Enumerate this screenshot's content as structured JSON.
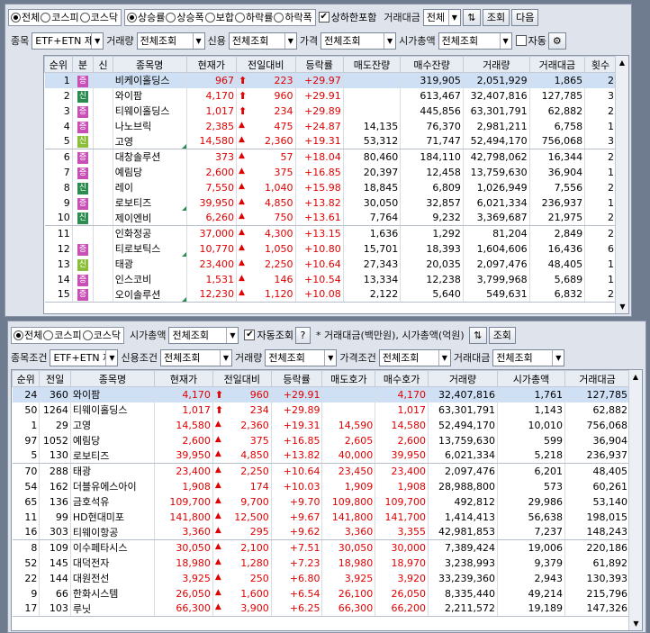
{
  "top": {
    "market_radios": [
      "전체",
      "코스피",
      "코스닥"
    ],
    "market_selected": 0,
    "sort_radios": [
      "상승률",
      "상승폭",
      "보합",
      "하락률",
      "하락폭"
    ],
    "sort_selected": 0,
    "limit_check_label": "상하한포함",
    "limit_checked": true,
    "amount_label": "거래대금",
    "amount_value": "전체",
    "query_label": "조회",
    "next_label": "다음",
    "item_label": "종목",
    "item_value": "ETF+ETN 제외",
    "volume_label": "거래량",
    "volume_value": "전체조회",
    "credit_label": "신용",
    "credit_value": "전체조회",
    "price_label": "가격",
    "price_value": "전체조회",
    "mcap_label": "시가총액",
    "mcap_value": "전체조회",
    "auto_label": "자동",
    "auto_checked": false,
    "columns": [
      "순위",
      "분",
      "신",
      "종목명",
      "현재가",
      "전일대비",
      "등락률",
      "매도잔량",
      "매수잔량",
      "거래량",
      "거래대금",
      "횟수"
    ],
    "rows": [
      {
        "rank": "1",
        "b": "증",
        "bt": "z",
        "name": "비케이홀딩스",
        "price": "967",
        "arrow": "up",
        "chg": "223",
        "rate": "+29.97",
        "ask": "",
        "bid": "319,905",
        "vol": "2,051,929",
        "amt": "1,865",
        "cnt": "2",
        "sel": true,
        "mark": false
      },
      {
        "rank": "2",
        "b": "신",
        "bt": "s",
        "name": "와이팜",
        "price": "4,170",
        "arrow": "up",
        "chg": "960",
        "rate": "+29.91",
        "ask": "",
        "bid": "613,467",
        "vol": "32,407,816",
        "amt": "127,785",
        "cnt": "3",
        "sel": false,
        "mark": false
      },
      {
        "rank": "3",
        "b": "증",
        "bt": "z",
        "name": "티웨이홀딩스",
        "price": "1,017",
        "arrow": "up",
        "chg": "234",
        "rate": "+29.89",
        "ask": "",
        "bid": "445,856",
        "vol": "63,301,791",
        "amt": "62,882",
        "cnt": "2",
        "sel": false,
        "mark": false
      },
      {
        "rank": "4",
        "b": "증",
        "bt": "z",
        "name": "나노브릭",
        "price": "2,385",
        "arrow": "tri",
        "chg": "475",
        "rate": "+24.87",
        "ask": "14,135",
        "bid": "76,370",
        "vol": "2,981,211",
        "amt": "6,758",
        "cnt": "1",
        "sel": false,
        "mark": false
      },
      {
        "rank": "5",
        "b": "신",
        "bt": "s2",
        "name": "고영",
        "price": "14,580",
        "arrow": "tri",
        "chg": "2,360",
        "rate": "+19.31",
        "ask": "53,312",
        "bid": "71,747",
        "vol": "52,494,170",
        "amt": "756,068",
        "cnt": "3",
        "sel": false,
        "mark": true
      },
      {
        "rank": "6",
        "b": "증",
        "bt": "z",
        "name": "대창솔루션",
        "price": "373",
        "arrow": "tri",
        "chg": "57",
        "rate": "+18.04",
        "ask": "80,460",
        "bid": "184,110",
        "vol": "42,798,062",
        "amt": "16,344",
        "cnt": "2",
        "sel": false,
        "mark": false
      },
      {
        "rank": "7",
        "b": "증",
        "bt": "z",
        "name": "예림당",
        "price": "2,600",
        "arrow": "tri",
        "chg": "375",
        "rate": "+16.85",
        "ask": "20,397",
        "bid": "12,458",
        "vol": "13,759,630",
        "amt": "36,904",
        "cnt": "1",
        "sel": false,
        "mark": false
      },
      {
        "rank": "8",
        "b": "신",
        "bt": "s",
        "name": "레이",
        "price": "7,550",
        "arrow": "tri",
        "chg": "1,040",
        "rate": "+15.98",
        "ask": "18,845",
        "bid": "6,809",
        "vol": "1,026,949",
        "amt": "7,556",
        "cnt": "2",
        "sel": false,
        "mark": false
      },
      {
        "rank": "9",
        "b": "증",
        "bt": "z",
        "name": "로보티즈",
        "price": "39,950",
        "arrow": "tri",
        "chg": "4,850",
        "rate": "+13.82",
        "ask": "30,050",
        "bid": "32,857",
        "vol": "6,021,334",
        "amt": "236,937",
        "cnt": "1",
        "sel": false,
        "mark": true
      },
      {
        "rank": "10",
        "b": "신",
        "bt": "s",
        "name": "제이엔비",
        "price": "6,260",
        "arrow": "tri",
        "chg": "750",
        "rate": "+13.61",
        "ask": "7,764",
        "bid": "9,232",
        "vol": "3,369,687",
        "amt": "21,975",
        "cnt": "2",
        "sel": false,
        "mark": false
      },
      {
        "rank": "11",
        "b": "",
        "bt": "",
        "name": "인화정공",
        "price": "37,000",
        "arrow": "tri",
        "chg": "4,300",
        "rate": "+13.15",
        "ask": "1,636",
        "bid": "1,292",
        "vol": "81,204",
        "amt": "2,849",
        "cnt": "2",
        "sel": false,
        "mark": false
      },
      {
        "rank": "12",
        "b": "증",
        "bt": "z",
        "name": "티로보틱스",
        "price": "10,770",
        "arrow": "tri",
        "chg": "1,050",
        "rate": "+10.80",
        "ask": "15,701",
        "bid": "18,393",
        "vol": "1,604,606",
        "amt": "16,436",
        "cnt": "6",
        "sel": false,
        "mark": true
      },
      {
        "rank": "13",
        "b": "신",
        "bt": "s2",
        "name": "태광",
        "price": "23,400",
        "arrow": "tri",
        "chg": "2,250",
        "rate": "+10.64",
        "ask": "27,343",
        "bid": "20,035",
        "vol": "2,097,476",
        "amt": "48,405",
        "cnt": "1",
        "sel": false,
        "mark": false
      },
      {
        "rank": "14",
        "b": "증",
        "bt": "z",
        "name": "인스코비",
        "price": "1,531",
        "arrow": "tri",
        "chg": "146",
        "rate": "+10.54",
        "ask": "13,334",
        "bid": "12,238",
        "vol": "3,799,968",
        "amt": "5,689",
        "cnt": "1",
        "sel": false,
        "mark": false
      },
      {
        "rank": "15",
        "b": "증",
        "bt": "z",
        "name": "오이솔루션",
        "price": "12,230",
        "arrow": "tri",
        "chg": "1,120",
        "rate": "+10.08",
        "ask": "2,122",
        "bid": "5,640",
        "vol": "549,631",
        "amt": "6,832",
        "cnt": "2",
        "sel": false,
        "mark": true
      }
    ]
  },
  "bottom": {
    "market_radios": [
      "전체",
      "코스피",
      "코스닥"
    ],
    "market_selected": 0,
    "mcap_label": "시가총액",
    "mcap_value": "전체조회",
    "auto_query_label": "자동조회",
    "auto_checked": true,
    "help_label": "?",
    "note": "* 거래대금(백만원), 시가총액(억원)",
    "query_label": "조회",
    "cond_label": "종목조건",
    "cond_value": "ETF+ETN 제외",
    "credit_label": "신용조건",
    "credit_value": "전체조회",
    "volume_label": "거래량",
    "volume_value": "전체조회",
    "price_label": "가격조건",
    "price_value": "전체조회",
    "amount_label": "거래대금",
    "amount_value": "전체조회",
    "columns": [
      "순위",
      "전일",
      "종목명",
      "현재가",
      "전일대비",
      "등락률",
      "매도호가",
      "매수호가",
      "거래량",
      "시가총액",
      "거래대금"
    ],
    "rows": [
      {
        "rank": "24",
        "prev": "360",
        "name": "와이팜",
        "price": "4,170",
        "arrow": "up",
        "chg": "960",
        "rate": "+29.91",
        "ask": "",
        "bid": "4,170",
        "vol": "32,407,816",
        "mcap": "1,761",
        "amt": "127,785",
        "sel": true
      },
      {
        "rank": "50",
        "prev": "1264",
        "name": "티웨이홀딩스",
        "price": "1,017",
        "arrow": "up",
        "chg": "234",
        "rate": "+29.89",
        "ask": "",
        "bid": "1,017",
        "vol": "63,301,791",
        "mcap": "1,143",
        "amt": "62,882",
        "sel": false
      },
      {
        "rank": "1",
        "prev": "29",
        "name": "고영",
        "price": "14,580",
        "arrow": "tri",
        "chg": "2,360",
        "rate": "+19.31",
        "ask": "14,590",
        "bid": "14,580",
        "vol": "52,494,170",
        "mcap": "10,010",
        "amt": "756,068",
        "sel": false
      },
      {
        "rank": "97",
        "prev": "1052",
        "name": "예림당",
        "price": "2,600",
        "arrow": "tri",
        "chg": "375",
        "rate": "+16.85",
        "ask": "2,605",
        "bid": "2,600",
        "vol": "13,759,630",
        "mcap": "599",
        "amt": "36,904",
        "sel": false
      },
      {
        "rank": "5",
        "prev": "130",
        "name": "로보티즈",
        "price": "39,950",
        "arrow": "tri",
        "chg": "4,850",
        "rate": "+13.82",
        "ask": "40,000",
        "bid": "39,950",
        "vol": "6,021,334",
        "mcap": "5,218",
        "amt": "236,937",
        "sel": false
      },
      {
        "rank": "70",
        "prev": "288",
        "name": "태광",
        "price": "23,400",
        "arrow": "tri",
        "chg": "2,250",
        "rate": "+10.64",
        "ask": "23,450",
        "bid": "23,400",
        "vol": "2,097,476",
        "mcap": "6,201",
        "amt": "48,405",
        "sel": false
      },
      {
        "rank": "54",
        "prev": "162",
        "name": "더블유에스아이",
        "price": "1,908",
        "arrow": "tri",
        "chg": "174",
        "rate": "+10.03",
        "ask": "1,909",
        "bid": "1,908",
        "vol": "28,988,800",
        "mcap": "573",
        "amt": "60,261",
        "sel": false
      },
      {
        "rank": "65",
        "prev": "136",
        "name": "금호석유",
        "price": "109,700",
        "arrow": "tri",
        "chg": "9,700",
        "rate": "+9.70",
        "ask": "109,800",
        "bid": "109,700",
        "vol": "492,812",
        "mcap": "29,986",
        "amt": "53,140",
        "sel": false
      },
      {
        "rank": "11",
        "prev": "99",
        "name": "HD현대미포",
        "price": "141,800",
        "arrow": "tri",
        "chg": "12,500",
        "rate": "+9.67",
        "ask": "141,800",
        "bid": "141,700",
        "vol": "1,414,413",
        "mcap": "56,638",
        "amt": "198,015",
        "sel": false
      },
      {
        "rank": "16",
        "prev": "303",
        "name": "티웨이항공",
        "price": "3,360",
        "arrow": "tri",
        "chg": "295",
        "rate": "+9.62",
        "ask": "3,360",
        "bid": "3,355",
        "vol": "42,981,853",
        "mcap": "7,237",
        "amt": "148,243",
        "sel": false
      },
      {
        "rank": "8",
        "prev": "109",
        "name": "이수페타시스",
        "price": "30,050",
        "arrow": "tri",
        "chg": "2,100",
        "rate": "+7.51",
        "ask": "30,050",
        "bid": "30,000",
        "vol": "7,389,424",
        "mcap": "19,006",
        "amt": "220,186",
        "sel": false
      },
      {
        "rank": "52",
        "prev": "145",
        "name": "대덕전자",
        "price": "18,980",
        "arrow": "tri",
        "chg": "1,280",
        "rate": "+7.23",
        "ask": "18,980",
        "bid": "18,970",
        "vol": "3,238,993",
        "mcap": "9,379",
        "amt": "61,892",
        "sel": false
      },
      {
        "rank": "22",
        "prev": "144",
        "name": "대원전선",
        "price": "3,925",
        "arrow": "tri",
        "chg": "250",
        "rate": "+6.80",
        "ask": "3,925",
        "bid": "3,920",
        "vol": "33,239,360",
        "mcap": "2,943",
        "amt": "130,393",
        "sel": false
      },
      {
        "rank": "9",
        "prev": "66",
        "name": "한화시스템",
        "price": "26,050",
        "arrow": "tri",
        "chg": "1,600",
        "rate": "+6.54",
        "ask": "26,100",
        "bid": "26,050",
        "vol": "8,335,440",
        "mcap": "49,214",
        "amt": "215,796",
        "sel": false
      },
      {
        "rank": "17",
        "prev": "103",
        "name": "루닛",
        "price": "66,300",
        "arrow": "tri",
        "chg": "3,900",
        "rate": "+6.25",
        "ask": "66,300",
        "bid": "66,200",
        "vol": "2,211,572",
        "mcap": "19,189",
        "amt": "147,326",
        "sel": false
      }
    ]
  }
}
